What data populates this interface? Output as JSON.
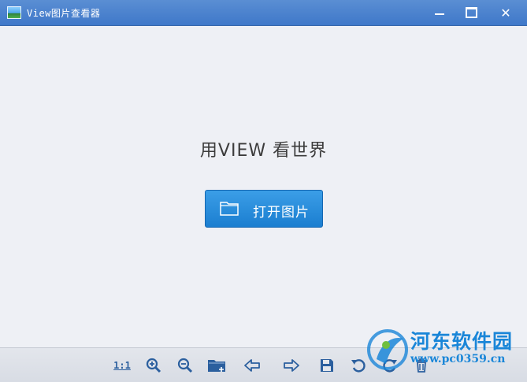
{
  "window": {
    "title": "View图片查看器",
    "app_icon": "landscape-image-icon",
    "controls": [
      "minimize-icon",
      "maximize-icon",
      "close-icon"
    ],
    "close_glyph": "✕"
  },
  "main": {
    "slogan": "用VIEW 看世界",
    "open_button": {
      "label": "打开图片",
      "icon": "folder-icon"
    }
  },
  "toolbar": {
    "actual_size_label": "1:1",
    "items": [
      "actual-size-button",
      "zoom-in-icon",
      "zoom-out-icon",
      "open-folder-icon",
      "previous-arrow-icon",
      "next-arrow-icon",
      "save-icon",
      "rotate-left-icon",
      "rotate-right-icon",
      "delete-icon"
    ]
  },
  "watermark": {
    "name": "河东软件园",
    "url": "www.pc0359.cn"
  },
  "colors": {
    "titlebar": "#4a84cf",
    "background": "#eef0f5",
    "button": "#1f86d6",
    "toolbar_icon": "#2b5f9e",
    "watermark": "#1a86d8"
  }
}
